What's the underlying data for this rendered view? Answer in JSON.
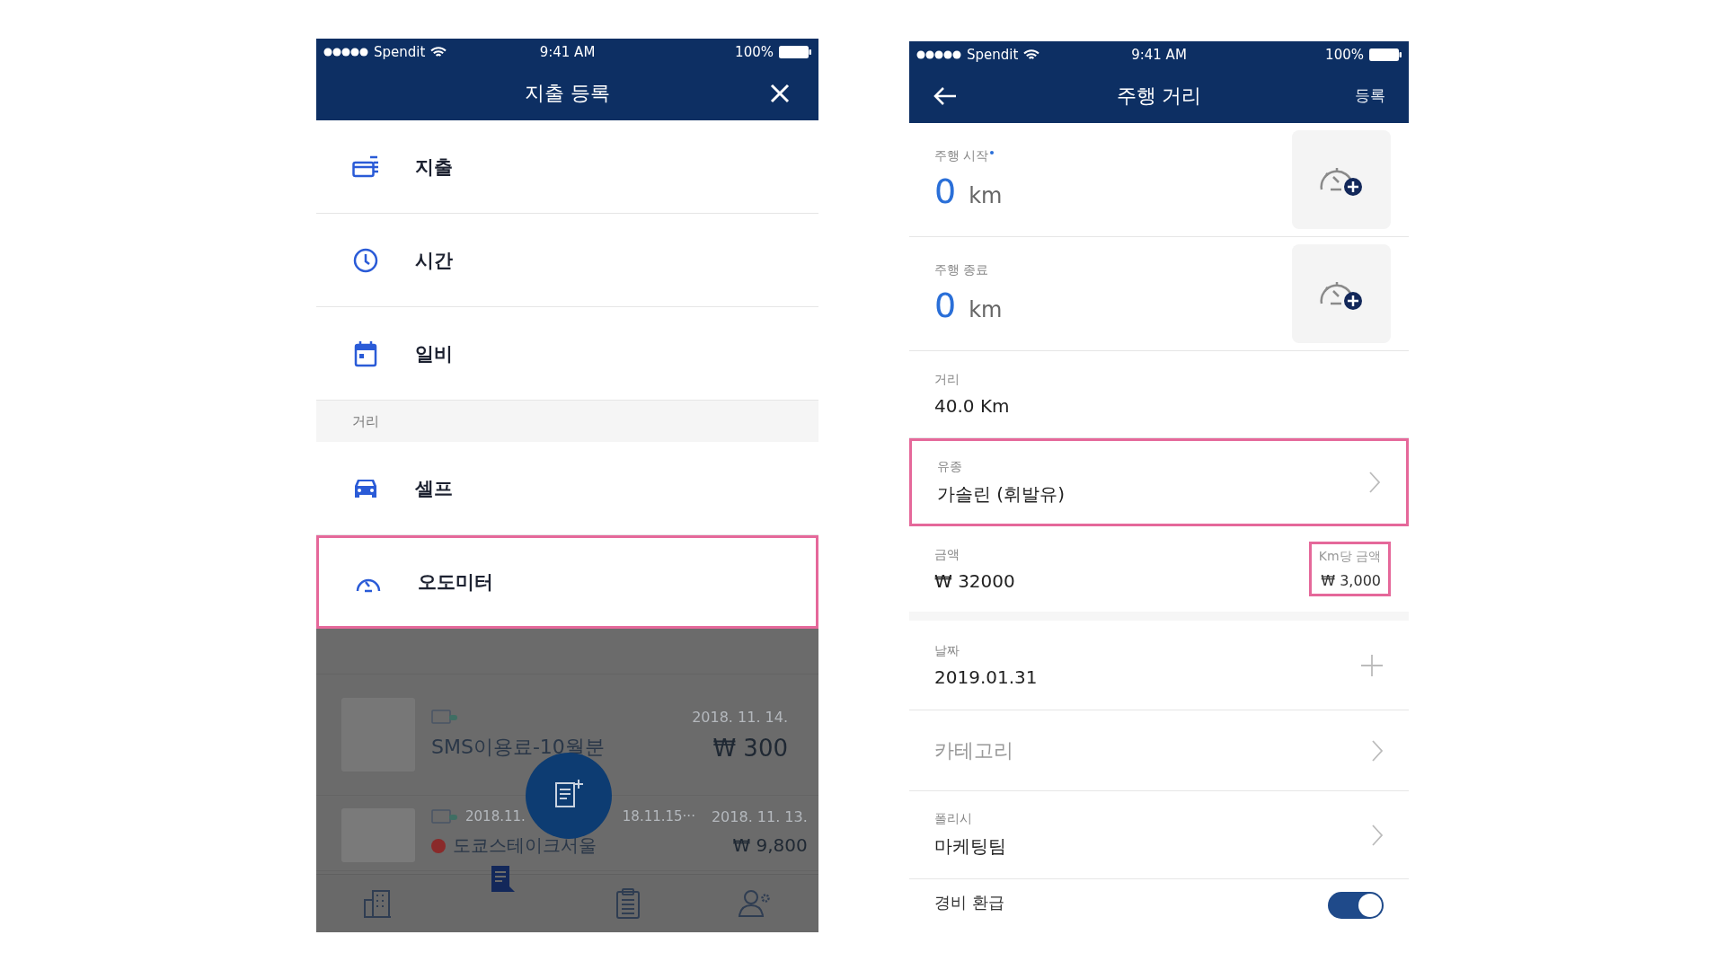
{
  "expense_menu": {
    "status_bar": {
      "carrier": "Spendit",
      "time": "9:41 AM",
      "battery": "100%"
    },
    "title": "지출 등록",
    "menu": [
      {
        "kind": "item",
        "label": "지출",
        "highlighted": false
      },
      {
        "kind": "item",
        "label": "시간",
        "highlighted": false
      },
      {
        "kind": "item",
        "label": "일비",
        "highlighted": false
      },
      {
        "kind": "section",
        "label": "거리"
      },
      {
        "kind": "item",
        "label": "셀프",
        "highlighted": false
      },
      {
        "kind": "item",
        "label": "오도미터",
        "highlighted": true
      }
    ],
    "background_list": [
      {
        "title": "SMS이용료-10월분",
        "date": "2018. 11. 14.",
        "amount": "₩ 300",
        "warning": false
      },
      {
        "period_start": "2018.11.",
        "period_end": "18.11.15···",
        "title": "도쿄스테이크서울",
        "date": "2018. 11. 13.",
        "amount": "₩ 9,800",
        "warning": true
      }
    ],
    "tab_bar": [
      {
        "selected": false
      },
      {
        "selected": true
      },
      {
        "selected": false
      },
      {
        "selected": false
      }
    ]
  },
  "mileage_form": {
    "status_bar": {
      "carrier": "Spendit",
      "time": "9:41 AM",
      "battery": "100%"
    },
    "title": "주행 거리",
    "action": "등록",
    "fields": [
      {
        "kind": "odometer",
        "label": "주행 시작",
        "required": true,
        "value": "0",
        "unit": "km"
      },
      {
        "kind": "odometer",
        "label": "주행 종료",
        "required": false,
        "value": "0",
        "unit": "km"
      },
      {
        "kind": "info",
        "label": "거리",
        "value": "40.0 Km"
      },
      {
        "kind": "select",
        "label": "유종",
        "value": "가솔린 (휘발유)",
        "highlighted": true
      },
      {
        "kind": "amount",
        "label": "금액",
        "value": "₩ 32000",
        "rate_label": "Km당 금액",
        "rate": "₩ 3,000",
        "rate_highlighted": true
      },
      {
        "kind": "date",
        "label": "날짜",
        "value": "2019.01.31"
      },
      {
        "kind": "select",
        "placeholder": "카테고리",
        "highlighted": false
      },
      {
        "kind": "select",
        "label": "폴리시",
        "value": "마케팅팀",
        "highlighted": false
      },
      {
        "kind": "toggle",
        "label": "경비 환급",
        "on": true
      }
    ]
  }
}
